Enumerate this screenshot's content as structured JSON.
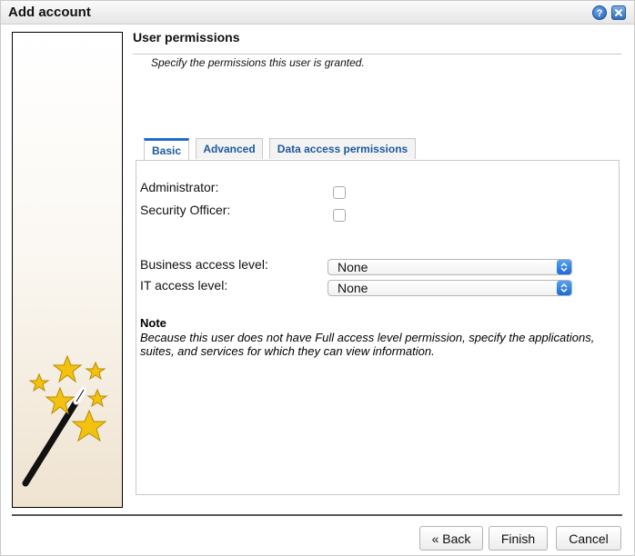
{
  "window": {
    "title": "Add account",
    "help_icon": "help-icon",
    "close_icon": "close-icon"
  },
  "wizard": {
    "art_icon": "magic-wand-with-stars-icon",
    "heading": "User permissions",
    "subheading": "Specify the permissions this user is granted."
  },
  "tabs": [
    {
      "label": "Basic",
      "active": true
    },
    {
      "label": "Advanced",
      "active": false
    },
    {
      "label": "Data access permissions",
      "active": false
    }
  ],
  "basic": {
    "administrator": {
      "label": "Administrator:",
      "checked": false
    },
    "security_officer": {
      "label": "Security Officer:",
      "checked": false
    },
    "business_access": {
      "label": "Business access level:",
      "value": "None"
    },
    "it_access": {
      "label": "IT access level:",
      "value": "None"
    },
    "note": {
      "title": "Note",
      "body": "Because this user does not have Full access level permission, specify the applications, suites, and services for which they can view information."
    }
  },
  "footer": {
    "back_label": "« Back",
    "finish_label": "Finish",
    "cancel_label": "Cancel"
  },
  "colors": {
    "tab_text": "#1c5a9c",
    "tab_active_accent": "#1d6fc9",
    "select_arrow": "#1b6ad6",
    "star": "#f3c20f"
  }
}
